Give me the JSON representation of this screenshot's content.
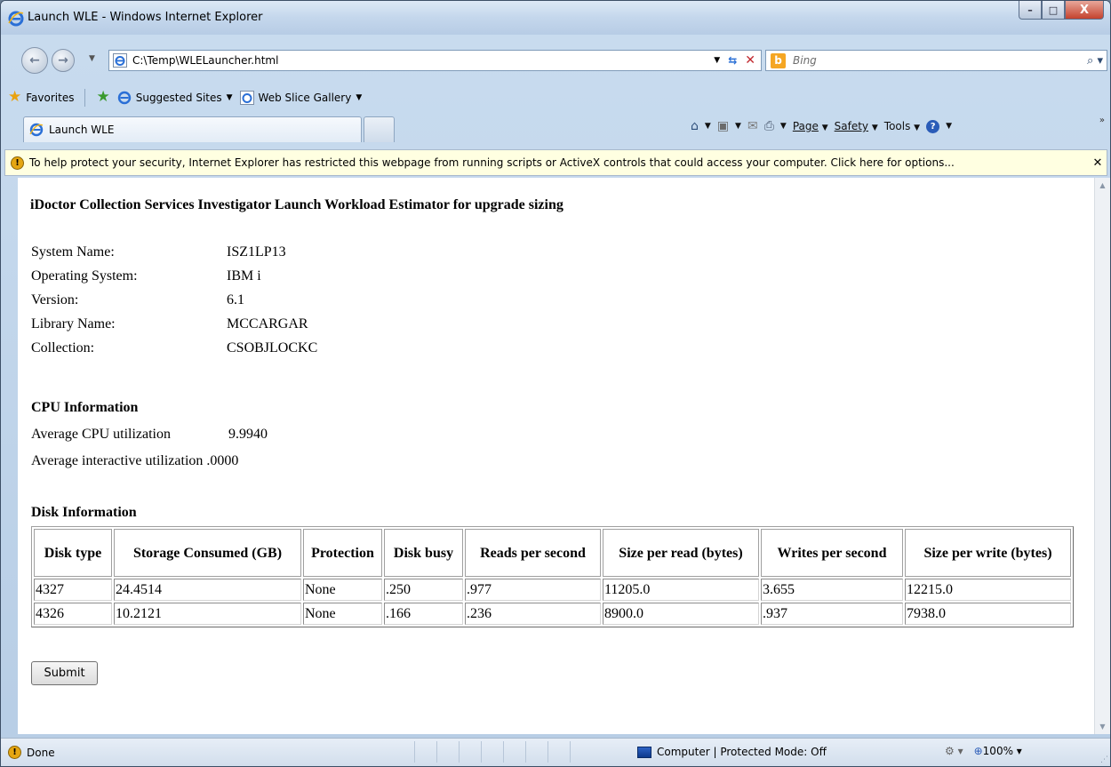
{
  "window": {
    "title": "Launch WLE - Windows Internet Explorer",
    "min": "–",
    "max": "□",
    "close": "X"
  },
  "address_bar": {
    "url": "C:\\Temp\\WLELauncher.html",
    "search_placeholder": "Bing"
  },
  "favorites_bar": {
    "favorites_label": "Favorites",
    "items": [
      {
        "label": "Suggested Sites"
      },
      {
        "label": "Web Slice Gallery"
      }
    ]
  },
  "tabs": {
    "active_label": "Launch WLE"
  },
  "command_bar": {
    "page": "Page",
    "safety": "Safety",
    "tools": "Tools"
  },
  "info_bar": {
    "text": "To help protect your security, Internet Explorer has restricted this webpage from running scripts or ActiveX controls that could access your computer. Click here for options..."
  },
  "page": {
    "title": "iDoctor Collection Services Investigator Launch Workload Estimator for upgrade sizing",
    "system_info": [
      {
        "label": "System Name:",
        "value": "ISZ1LP13"
      },
      {
        "label": "Operating System:",
        "value": "IBM i"
      },
      {
        "label": "Version:",
        "value": "6.1"
      },
      {
        "label": "Library Name:",
        "value": "MCCARGAR"
      },
      {
        "label": "Collection:",
        "value": "CSOBJLOCKC"
      }
    ],
    "cpu": {
      "heading": "CPU Information",
      "avg_cpu_label": "Average CPU utilization",
      "avg_cpu_value": "9.9940",
      "avg_interactive_label": "Average interactive utilization",
      "avg_interactive_value": ".0000"
    },
    "disk": {
      "heading": "Disk Information",
      "columns": [
        "Disk type",
        "Storage Consumed (GB)",
        "Protection",
        "Disk busy",
        "Reads per second",
        "Size per read (bytes)",
        "Writes per second",
        "Size per write (bytes)"
      ],
      "rows": [
        [
          "4327",
          "24.4514",
          "None",
          ".250",
          ".977",
          "11205.0",
          "3.655",
          "12215.0"
        ],
        [
          "4326",
          "10.2121",
          "None",
          ".166",
          ".236",
          "8900.0",
          ".937",
          "7938.0"
        ]
      ]
    },
    "submit_label": "Submit"
  },
  "status_bar": {
    "status": "Done",
    "zone": "Computer | Protected Mode: Off",
    "zoom": "100%"
  }
}
